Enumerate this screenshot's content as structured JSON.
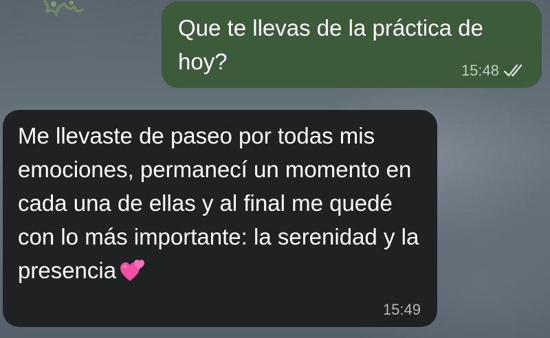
{
  "conversation": {
    "messages": [
      {
        "direction": "outgoing",
        "text": "Que te llevas de la práctica de hoy?",
        "time": "15:48",
        "status_icon": "double-check-read-icon"
      },
      {
        "direction": "incoming",
        "text": "Me llevaste de paseo por todas mis emociones, permanecí un momento en cada una de ellas y al final me quedé con lo más importante: la serenidad y la presencia",
        "emoji_icon": "two-hearts-icon",
        "time": "15:49"
      }
    ]
  },
  "colors": {
    "outgoing_bubble": "#3d5a3b",
    "incoming_bubble": "#1f2122",
    "text": "#ffffff"
  }
}
